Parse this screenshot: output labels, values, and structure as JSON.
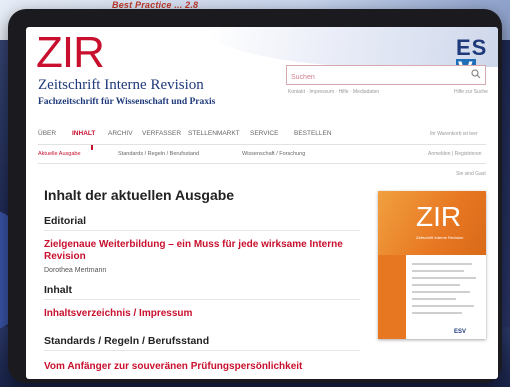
{
  "background": {
    "top_text": "Best Practice ... 2.8"
  },
  "header": {
    "logo": "ZIR",
    "title": "Zeitschrift Interne Revision",
    "subtitle": "Fachzeitschrift für Wissenschaft und Praxis",
    "publisher_logo_a": "ES",
    "publisher_logo_b": "V"
  },
  "search": {
    "placeholder": "Suchen",
    "value": ""
  },
  "utility_links": "Kontakt · Impressum · Hilfe · Mediadaten",
  "utility_right": "Hilfe zur Suche",
  "main_nav": {
    "items": [
      "ÜBER",
      "INHALT",
      "ARCHIV",
      "VERFASSER",
      "STELLENMARKT",
      "SERVICE",
      "BESTELLEN"
    ],
    "active": "INHALT",
    "right": "Ihr Warenkorb ist leer"
  },
  "sub_nav": {
    "items": [
      "Aktuelle Ausgabe",
      "Standards / Regeln / Berufsstand",
      "Wissenschaft / Forschung"
    ],
    "active": "Aktuelle Ausgabe",
    "right": "Anmelden | Registrieren"
  },
  "user_status": "Sie sind Gast",
  "content": {
    "heading": "Inhalt der aktuellen Ausgabe",
    "sections": [
      {
        "title": "Editorial",
        "articles": [
          {
            "title": "Zielgenaue Weiterbildung – ein Muss für jede wirksame Interne Revision",
            "author": "Dorothea Mertmann"
          }
        ]
      },
      {
        "title": "Inhalt",
        "articles": [
          {
            "title": "Inhaltsverzeichnis / Impressum",
            "author": ""
          }
        ]
      },
      {
        "title": "Standards / Regeln / Berufsstand",
        "articles": [
          {
            "title": "Vom Anfänger zur souveränen Prüfungspersönlichkeit",
            "author": ""
          }
        ]
      }
    ]
  },
  "cover": {
    "title": "ZIR",
    "subtitle": "Zeitschrift Interne Revision",
    "logo": "ESV"
  },
  "colors": {
    "accent": "#c8102e",
    "brand_blue": "#1f3a7a",
    "cover_orange": "#e87722"
  }
}
